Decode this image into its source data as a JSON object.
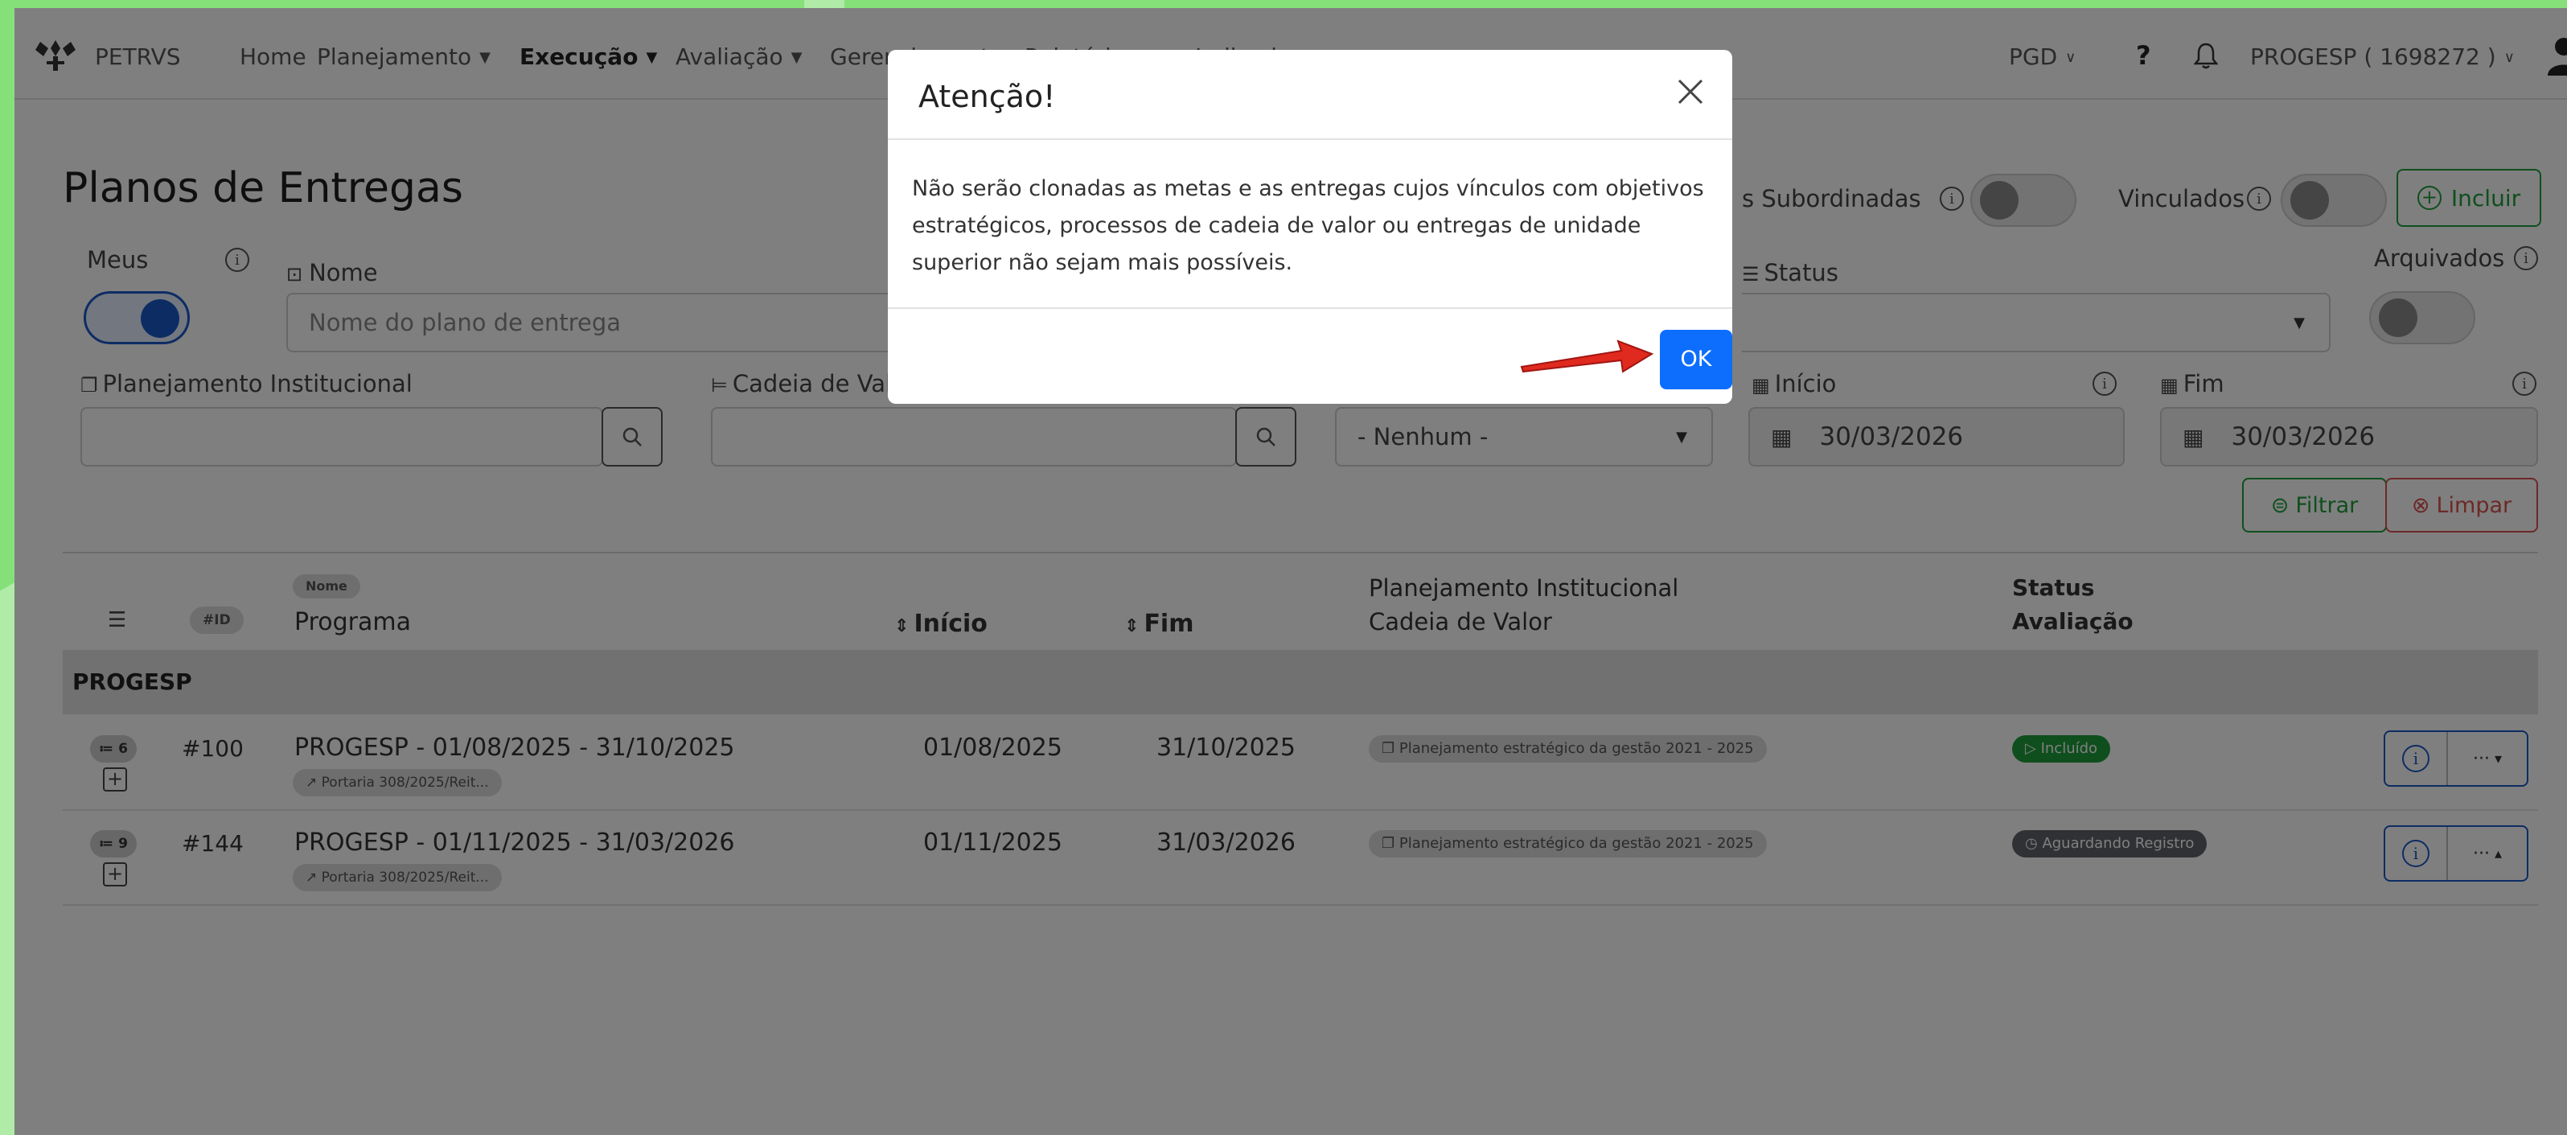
{
  "app": {
    "brand": "PETRVS"
  },
  "nav": {
    "items": [
      {
        "label": "Home",
        "has_caret": false
      },
      {
        "label": "Planejamento",
        "has_caret": true
      },
      {
        "label": "Execução",
        "has_caret": true,
        "active": true
      },
      {
        "label": "Avaliação",
        "has_caret": true
      },
      {
        "label": "Gerenciamento",
        "has_caret": true
      },
      {
        "label": "Relatórios",
        "has_caret": true
      },
      {
        "label": "Indicadores",
        "has_caret": true
      }
    ],
    "right": {
      "module": "PGD",
      "help": "?",
      "user": "PROGESP ( 1698272 )"
    }
  },
  "page": {
    "title": "Planos de Entregas",
    "filters": {
      "meus_label": "Meus",
      "nome_label": "Nome",
      "nome_placeholder": "Nome do plano de entrega",
      "subordinadas_label": "s Subordinadas",
      "vinculados_label": "Vinculados",
      "incluir_label": "Incluir",
      "status_label": "Status",
      "arquivados_label": "Arquivados",
      "planejamento_label": "Planejamento Institucional",
      "cadeia_label": "Cadeia de Val",
      "select_value": "- Nenhum -",
      "inicio_label": "Início",
      "inicio_value": "30/03/2026",
      "fim_label": "Fim",
      "fim_value": "30/03/2026",
      "filtrar_label": "Filtrar",
      "limpar_label": "Limpar"
    }
  },
  "table": {
    "headers": {
      "id": "#ID",
      "nome_badge": "Nome",
      "programa": "Programa",
      "inicio": "Início",
      "fim": "Fim",
      "planejamento": "Planejamento Institucional",
      "cadeia": "Cadeia de Valor",
      "status": "Status",
      "avaliacao": "Avaliação"
    },
    "group": "PROGESP",
    "rows": [
      {
        "count": "6",
        "id": "#100",
        "programa": "PROGESP - 01/08/2025 - 31/10/2025",
        "portaria": "Portaria 308/2025/Reit...",
        "inicio": "01/08/2025",
        "fim": "31/10/2025",
        "planejamento": "Planejamento estratégico da gestão 2021 - 2025",
        "status": "Incluído",
        "more_caret": "▾"
      },
      {
        "count": "9",
        "id": "#144",
        "programa": "PROGESP - 01/11/2025 - 31/03/2026",
        "portaria": "Portaria 308/2025/Reit...",
        "inicio": "01/11/2025",
        "fim": "31/03/2026",
        "planejamento": "Planejamento estratégico da gestão 2021 - 2025",
        "status": "Aguardando Registro",
        "more_caret": "▴"
      }
    ]
  },
  "modal": {
    "title": "Atenção!",
    "body": "Não serão clonadas as metas e as entregas cujos vínculos com objetivos estratégicos, processos de cadeia de valor ou entregas de unidade superior não sejam mais possíveis.",
    "ok_label": "OK"
  },
  "colors": {
    "accent": "#0d6efd",
    "success": "#1e9e3a",
    "danger": "#d9534f",
    "background": "#86e07a"
  }
}
